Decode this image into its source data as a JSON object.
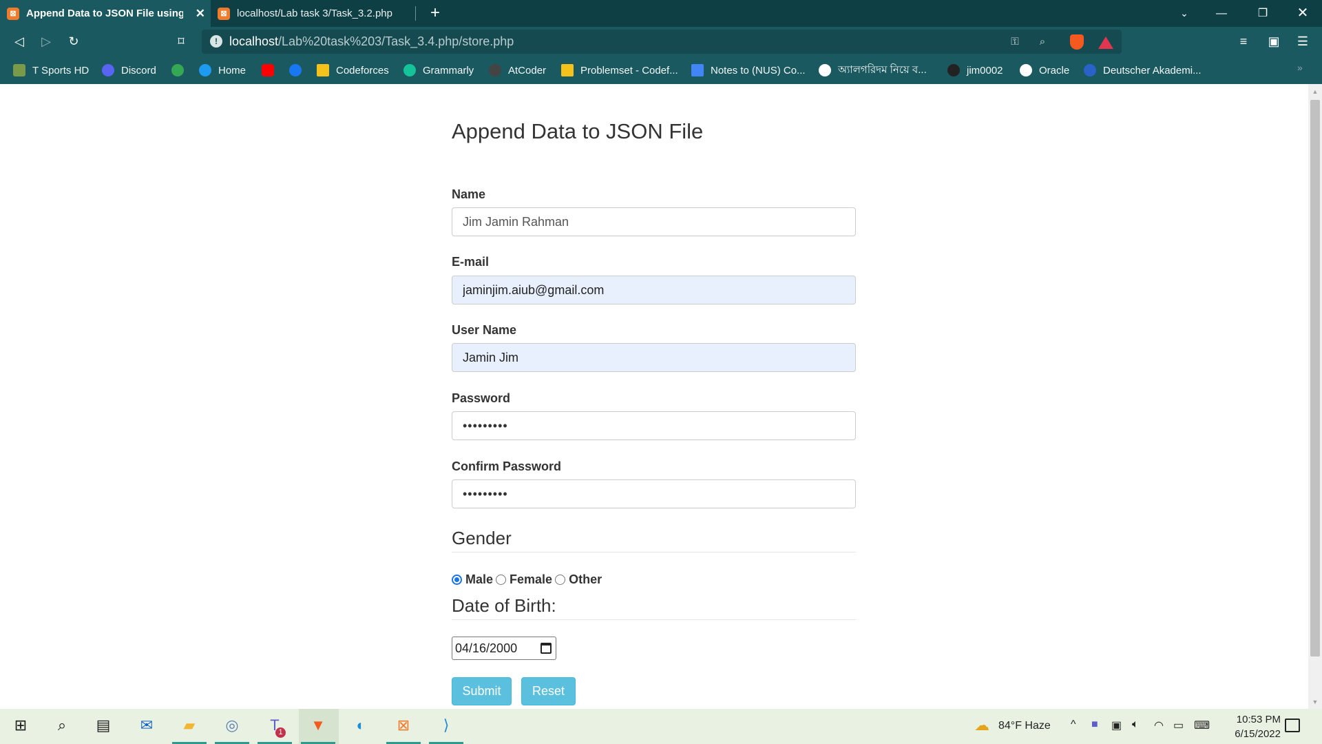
{
  "browser": {
    "tabs": [
      {
        "title": "Append Data to JSON File using P",
        "active": true
      },
      {
        "title": "localhost/Lab task 3/Task_3.2.php",
        "active": false
      }
    ],
    "url_host": "localhost",
    "url_path": "/Lab%20task%203/Task_3.4.php/store.php",
    "bookmarks": [
      {
        "label": "T Sports HD",
        "color": "#7a9a4a"
      },
      {
        "label": "Discord",
        "color": "#5865f2"
      },
      {
        "label": "",
        "color": "#34a853"
      },
      {
        "label": "Home",
        "color": "#1d9bf0"
      },
      {
        "label": "",
        "color": "#ff0000"
      },
      {
        "label": "",
        "color": "#1877f2"
      },
      {
        "label": "Codeforces",
        "color": "#f4c21b"
      },
      {
        "label": "Grammarly",
        "color": "#15c39a"
      },
      {
        "label": "AtCoder",
        "color": "#444444"
      },
      {
        "label": "Problemset - Codef...",
        "color": "#f4c21b"
      },
      {
        "label": "Notes to (NUS) Co...",
        "color": "#4285f4"
      },
      {
        "label": "অ্যালগরিদম নিয়ে ব...",
        "color": "#ffffff"
      },
      {
        "label": "jim0002",
        "color": "#222222"
      },
      {
        "label": "Oracle",
        "color": "#ffffff"
      },
      {
        "label": "Deutscher Akademi...",
        "color": "#2a62c9"
      }
    ]
  },
  "form": {
    "title": "Append Data to JSON File",
    "name_label": "Name",
    "name_value": "Jim Jamin Rahman",
    "email_label": "E-mail",
    "email_value": "jaminjim.aiub@gmail.com",
    "username_label": "User Name",
    "username_value": "Jamin Jim",
    "password_label": "Password",
    "password_value": "•••••••••",
    "confirm_label": "Confirm Password",
    "confirm_value": "•••••••••",
    "gender_heading": "Gender",
    "gender_options": [
      "Male",
      "Female",
      "Other"
    ],
    "gender_selected": "Male",
    "dob_heading": "Date of Birth:",
    "dob_value": "04/16/2000",
    "submit_label": "Submit",
    "reset_label": "Reset"
  },
  "taskbar": {
    "weather": "84°F  Haze",
    "time": "10:53 PM",
    "date": "6/15/2022",
    "teams_badge": "1"
  },
  "colors": {
    "tab_strip": "#0e3f45",
    "toolbar": "#1a5960",
    "button": "#5bc0de",
    "autofill": "#e8f0fe"
  }
}
